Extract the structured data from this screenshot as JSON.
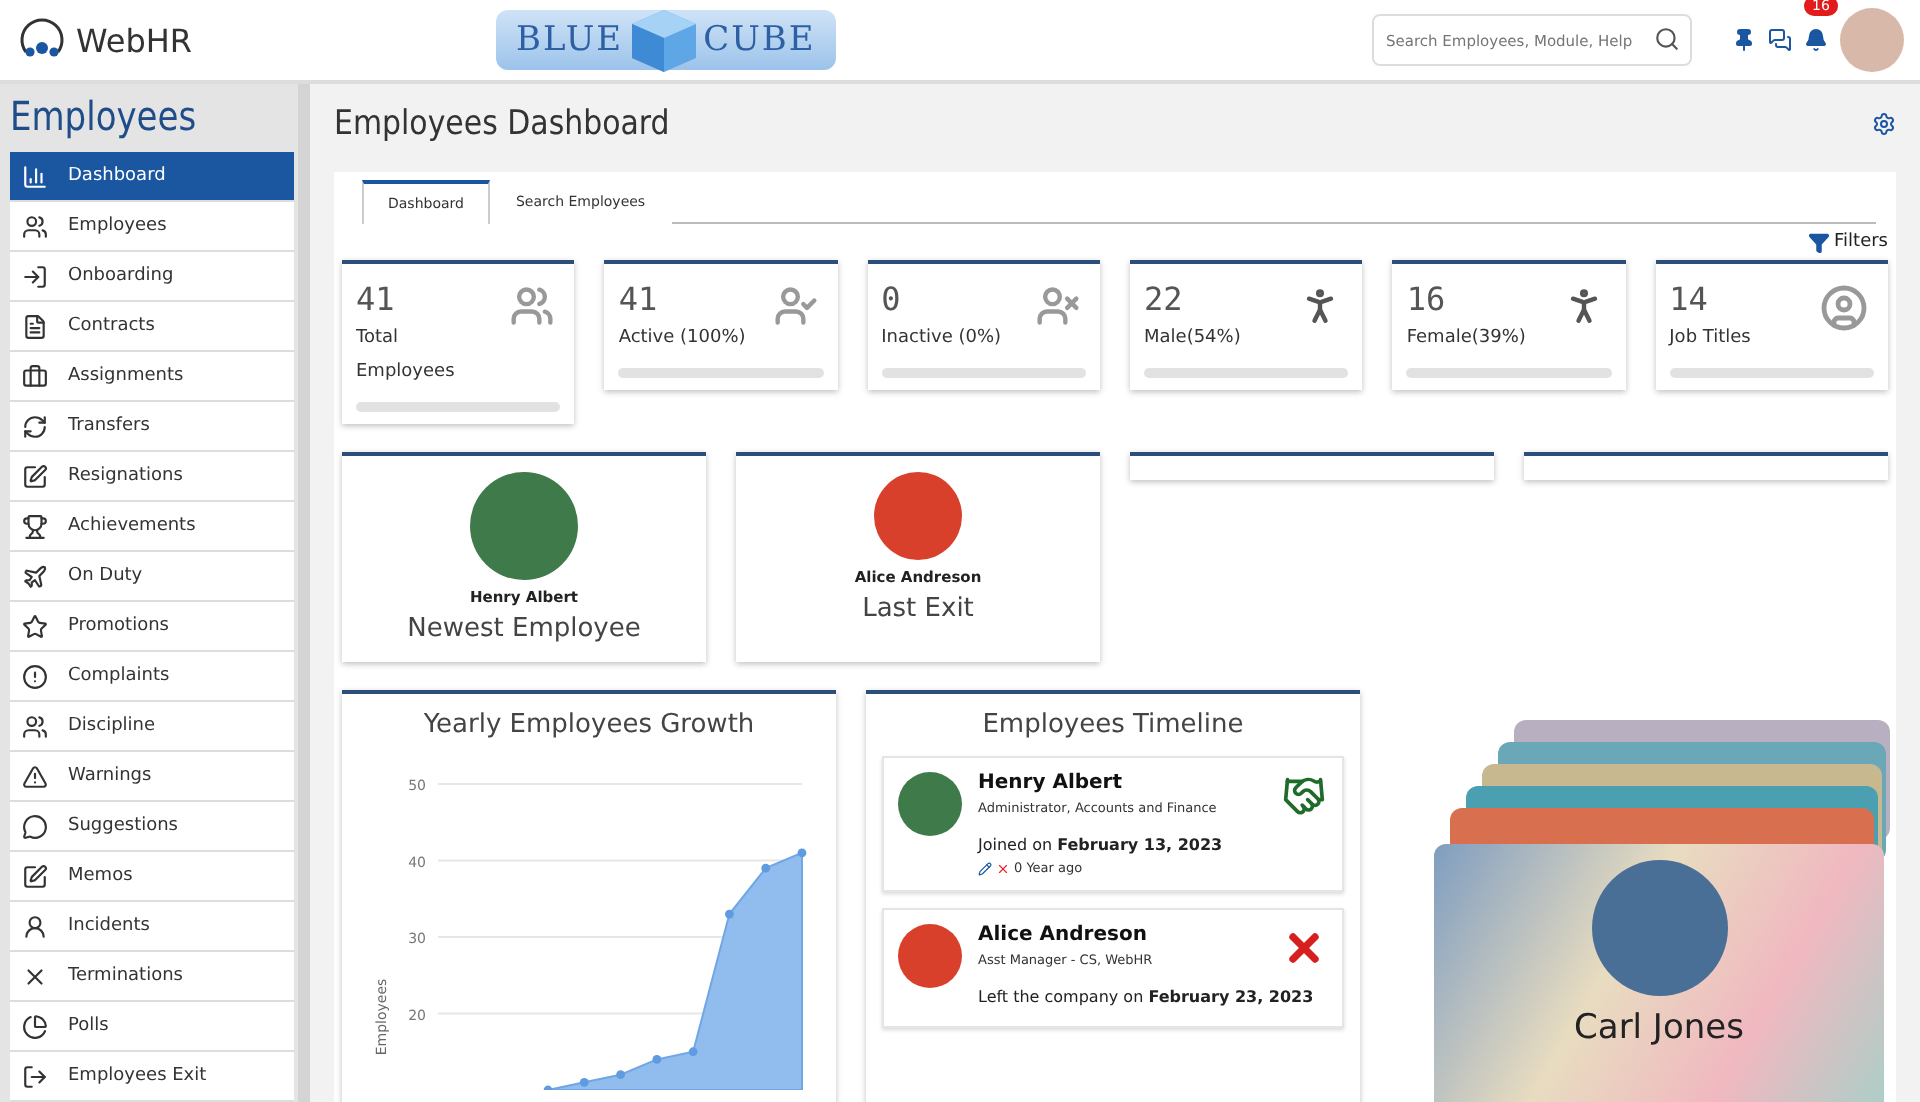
{
  "header": {
    "brand": "WebHR",
    "logo_left": "BLUE",
    "logo_right": "CUBE",
    "search": {
      "placeholder": "Search Employees, Module, Help"
    },
    "notification_count": "16"
  },
  "sidebar": {
    "title": "Employees",
    "items": [
      {
        "label": "Dashboard",
        "selected": true
      },
      {
        "label": "Employees",
        "selected": false
      },
      {
        "label": "Onboarding",
        "selected": false
      },
      {
        "label": "Contracts",
        "selected": false
      },
      {
        "label": "Assignments",
        "selected": false
      },
      {
        "label": "Transfers",
        "selected": false
      },
      {
        "label": "Resignations",
        "selected": false
      },
      {
        "label": "Achievements",
        "selected": false
      },
      {
        "label": "On Duty",
        "selected": false
      },
      {
        "label": "Promotions",
        "selected": false
      },
      {
        "label": "Complaints",
        "selected": false
      },
      {
        "label": "Discipline",
        "selected": false
      },
      {
        "label": "Warnings",
        "selected": false
      },
      {
        "label": "Suggestions",
        "selected": false
      },
      {
        "label": "Memos",
        "selected": false
      },
      {
        "label": "Incidents",
        "selected": false
      },
      {
        "label": "Terminations",
        "selected": false
      },
      {
        "label": "Polls",
        "selected": false
      },
      {
        "label": "Employees Exit",
        "selected": false
      }
    ]
  },
  "page_title": "Employees Dashboard",
  "tabs": [
    {
      "label": "Dashboard",
      "selected": true
    },
    {
      "label": "Search Employees",
      "selected": false
    }
  ],
  "filters_label": "Filters",
  "stats": [
    {
      "value": "41",
      "label": "Total Employees",
      "kind": "group"
    },
    {
      "value": "41",
      "label": "Active (100%)",
      "kind": "active"
    },
    {
      "value": "0",
      "label": "Inactive (0%)",
      "kind": "inactive"
    },
    {
      "value": "22",
      "label": "Male(54%)",
      "kind": "male"
    },
    {
      "value": "16",
      "label": "Female(39%)",
      "kind": "female"
    },
    {
      "value": "14",
      "label": "Job Titles",
      "kind": "titles"
    }
  ],
  "people_cards": [
    {
      "name": "Henry Albert",
      "caption": "Newest Employee",
      "color": "#3f7a4a"
    },
    {
      "name": "Alice Andreson",
      "caption": "Last Exit",
      "color": "#d9402b"
    }
  ],
  "growth": {
    "title": "Yearly Employees Growth",
    "chart_data": {
      "type": "area",
      "ylabel": "Employees",
      "ylim": [
        10,
        50
      ],
      "yticks": [
        20,
        30,
        40,
        50
      ],
      "grid": true,
      "series": [
        {
          "color": "#90bdee",
          "values": [
            10,
            11,
            12,
            14,
            15,
            33,
            39,
            41
          ]
        }
      ]
    }
  },
  "timeline": {
    "title": "Employees Timeline",
    "entries": [
      {
        "name": "Henry Albert",
        "role": "Administrator, Accounts and Finance",
        "event": "Joined on **February 13, 2023**",
        "ago": "0 Year ago",
        "kind": "joined",
        "color": "#3f7a4a"
      },
      {
        "name": "Alice Andreson",
        "role": "Asst Manager - CS, WebHR",
        "event": "Left the company on **February 23, 2023**",
        "kind": "left",
        "color": "#d9402b"
      }
    ]
  },
  "card_stack": {
    "name": "Carl Jones"
  }
}
